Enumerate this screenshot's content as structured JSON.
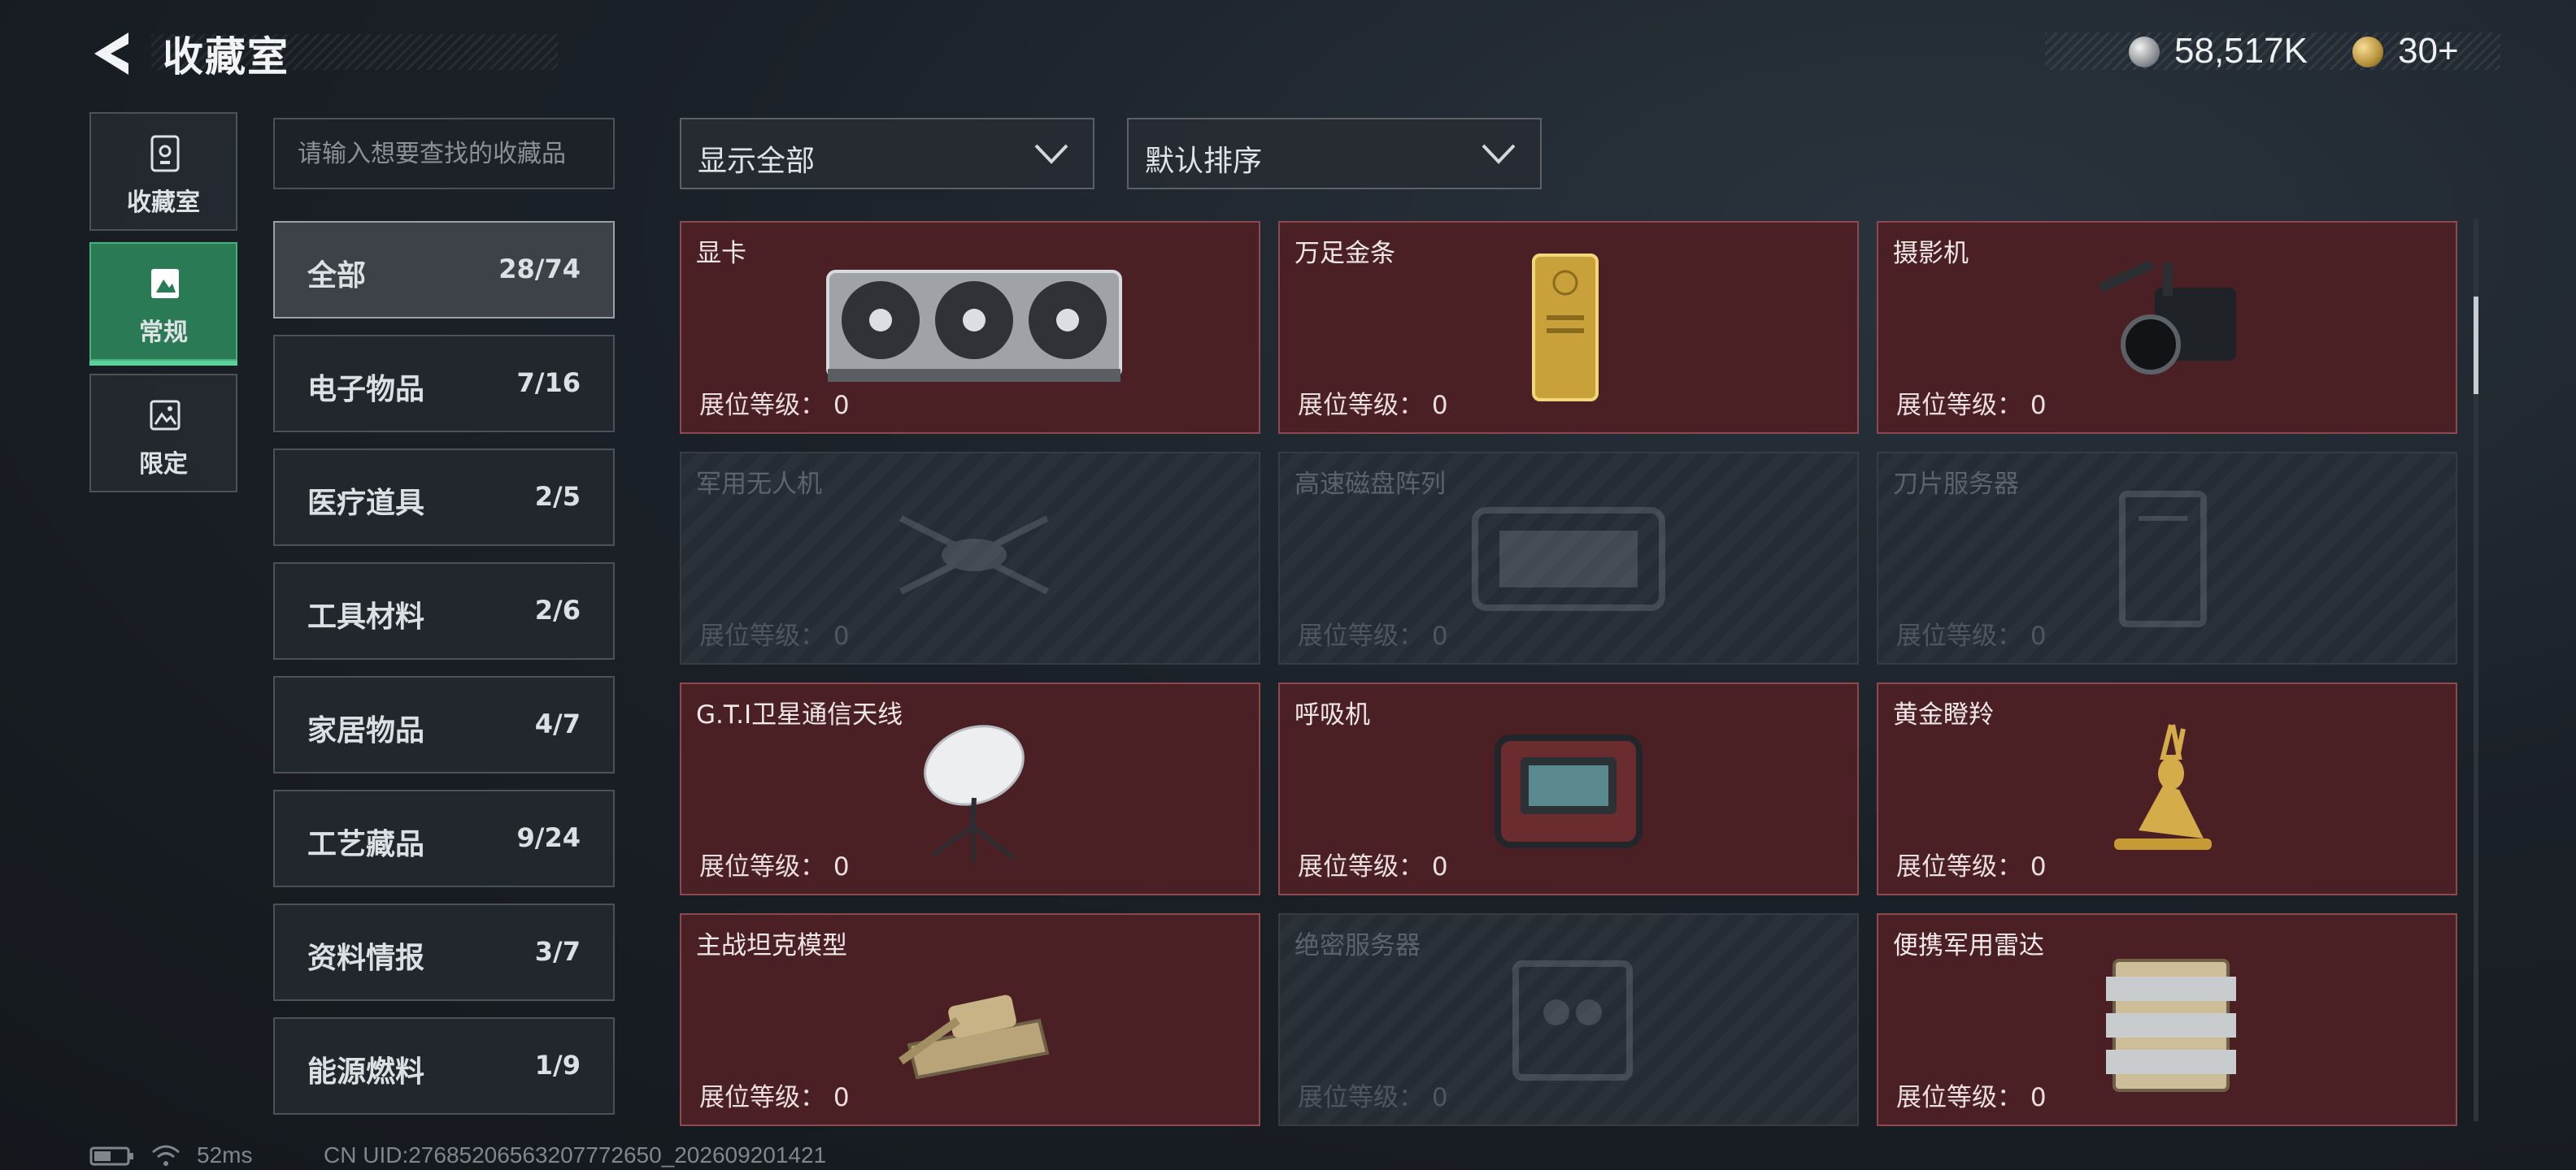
{
  "header": {
    "title": "收藏室",
    "currency_silver": "58,517K",
    "currency_gold": "30+"
  },
  "rail": [
    {
      "label": "收藏室",
      "icon": "vault-icon"
    },
    {
      "label": "常规",
      "icon": "image-icon"
    },
    {
      "label": "限定",
      "icon": "gallery-icon"
    }
  ],
  "search": {
    "placeholder": "请输入想要查找的收藏品"
  },
  "categories": [
    {
      "name": "全部",
      "count": "28/74"
    },
    {
      "name": "电子物品",
      "count": "7/16"
    },
    {
      "name": "医疗道具",
      "count": "2/5"
    },
    {
      "name": "工具材料",
      "count": "2/6"
    },
    {
      "name": "家居物品",
      "count": "4/7"
    },
    {
      "name": "工艺藏品",
      "count": "9/24"
    },
    {
      "name": "资料情报",
      "count": "3/7"
    },
    {
      "name": "能源燃料",
      "count": "1/9"
    }
  ],
  "filters": {
    "display": "显示全部",
    "sort": "默认排序"
  },
  "level_label": "展位等级：",
  "items": [
    {
      "name": "显卡",
      "level": "0",
      "owned": true
    },
    {
      "name": "万足金条",
      "level": "0",
      "owned": true
    },
    {
      "name": "摄影机",
      "level": "0",
      "owned": true
    },
    {
      "name": "军用无人机",
      "level": "0",
      "owned": false
    },
    {
      "name": "高速磁盘阵列",
      "level": "0",
      "owned": false
    },
    {
      "name": "刀片服务器",
      "level": "0",
      "owned": false
    },
    {
      "name": "G.T.I卫星通信天线",
      "level": "0",
      "owned": true
    },
    {
      "name": "呼吸机",
      "level": "0",
      "owned": true
    },
    {
      "name": "黄金瞪羚",
      "level": "0",
      "owned": true
    },
    {
      "name": "主战坦克模型",
      "level": "0",
      "owned": true
    },
    {
      "name": "绝密服务器",
      "level": "0",
      "owned": false
    },
    {
      "name": "便携军用雷达",
      "level": "0",
      "owned": true
    }
  ],
  "footer": {
    "ping": "52ms",
    "uid": "CN UID:2768520656320777265​0_202609201421"
  }
}
